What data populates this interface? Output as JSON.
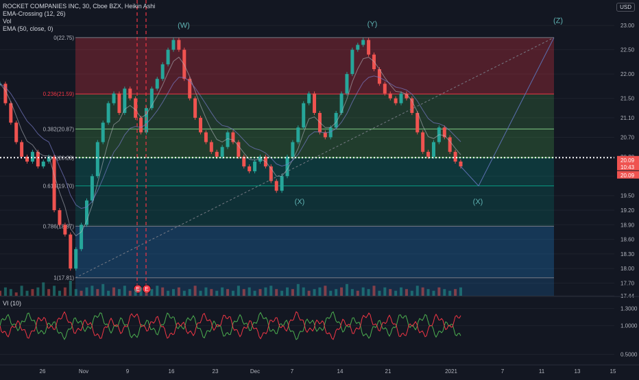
{
  "legend": {
    "title": "ROCKET COMPANIES INC, 30, Cboe BZX, Heikin Ashi",
    "line2": "EMA-Crossing (12, 26)",
    "line3": "Vol",
    "line4": "EMA (50, close, 0)"
  },
  "currency": "USD",
  "vi_legend": "VI (10)",
  "colors": {
    "background": "#131722",
    "up": "#26a69a",
    "down": "#ef5350",
    "grid": "#1e222d",
    "fib_text": "#b2b5be"
  },
  "price_labels": {
    "last_price": "20.09",
    "countdown": "10:43",
    "close_price": "20.09"
  },
  "chart_data": [
    {
      "type": "line",
      "title": "ROCKET COMPANIES INC, 30, Cboe BZX, Heikin Ashi",
      "ylim": [
        17.44,
        23.1
      ],
      "y_ticks": [
        "23.00",
        "22.50",
        "22.00",
        "21.50",
        "21.10",
        "20.70",
        "20.30",
        "19.90",
        "19.50",
        "19.20",
        "18.90",
        "18.60",
        "18.30",
        "18.00",
        "17.70",
        "17.44"
      ],
      "x_ticks": [
        "26",
        "Nov",
        "9",
        "16",
        "23",
        "Dec",
        "7",
        "14",
        "21",
        "2021",
        "7",
        "11",
        "13",
        "15"
      ],
      "fib_levels": [
        {
          "label": "0(22.75)",
          "value": 22.75
        },
        {
          "label": "0.236(21.59)",
          "value": 21.59
        },
        {
          "label": "0.382(20.87)",
          "value": 20.87
        },
        {
          "label": "0.5(20.28)",
          "value": 20.28
        },
        {
          "label": "0.618(19.70)",
          "value": 19.7
        },
        {
          "label": "0.786(18.87)",
          "value": 18.87
        },
        {
          "label": "1(17.81)",
          "value": 17.81
        }
      ],
      "wave_labels": [
        "(W)",
        "(X)",
        "(Y)",
        "(X)",
        "(Z)"
      ],
      "event_markers": [
        "E",
        "E"
      ],
      "series": [
        {
          "values": [
            21.8,
            21.4,
            21.0,
            20.6,
            20.3,
            20.2,
            20.4,
            20.1,
            20.2,
            20.3,
            19.2,
            18.9,
            18.7,
            18.0,
            18.4,
            18.9,
            19.4,
            19.9,
            20.6,
            21.0,
            21.4,
            21.6,
            21.2,
            21.7,
            21.5,
            21.1,
            20.8,
            21.3,
            21.7,
            21.9,
            22.2,
            22.5,
            22.7,
            22.5,
            21.9,
            21.5,
            21.1,
            20.8,
            20.6,
            20.4,
            20.3,
            20.5,
            20.8,
            20.6,
            20.3,
            20.1,
            20.0,
            20.2,
            20.3,
            20.1,
            19.8,
            19.6,
            19.9,
            20.3,
            20.6,
            20.9,
            21.4,
            21.6,
            21.2,
            20.8,
            20.7,
            20.9,
            21.2,
            21.6,
            22.0,
            22.5,
            22.6,
            22.7,
            22.4,
            22.1,
            21.8,
            21.6,
            21.5,
            21.4,
            21.6,
            21.5,
            21.2,
            20.8,
            20.4,
            20.3,
            20.6,
            20.9,
            20.7,
            20.4,
            20.2,
            20.1
          ]
        }
      ],
      "projection": {
        "values": [
          20.1,
          19.7,
          22.75
        ]
      },
      "volume": {
        "values": [
          3,
          5,
          4,
          2,
          6,
          3,
          4,
          5,
          8,
          4,
          6,
          3,
          5,
          9,
          4,
          3,
          5,
          6,
          4,
          7,
          3,
          5,
          4,
          6,
          3,
          4,
          5,
          3,
          4,
          6,
          5,
          3,
          4,
          5,
          3,
          4,
          6,
          3,
          5,
          4,
          3,
          5,
          4,
          3,
          6,
          4,
          5,
          3,
          4,
          5,
          6,
          4,
          3,
          5,
          4,
          7,
          5,
          3,
          4,
          5,
          6,
          3,
          4,
          5,
          7,
          4,
          3,
          5,
          4,
          6,
          3,
          5,
          4,
          3,
          5,
          4,
          3,
          6,
          5,
          4,
          3,
          5,
          4,
          3,
          4,
          5
        ]
      },
      "vi_ylim": [
        0.35,
        1.45
      ],
      "vi_ticks": [
        "1.3000",
        "1.0000",
        "0.5000"
      ]
    }
  ]
}
